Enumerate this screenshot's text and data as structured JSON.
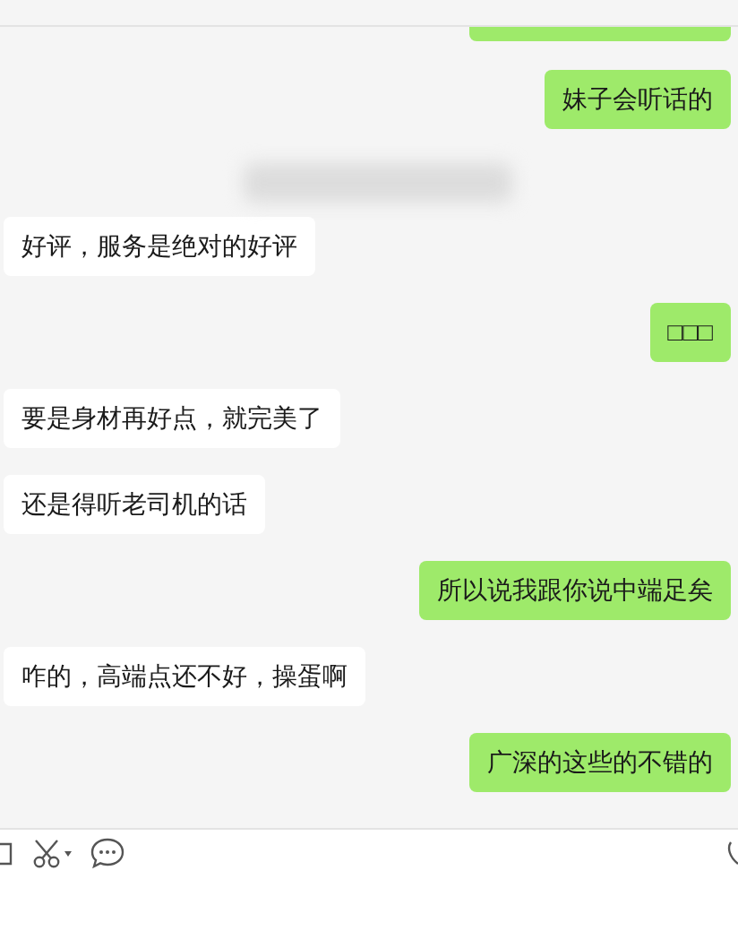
{
  "messages": [
    {
      "kind": "sent",
      "text": "妹子会听话的"
    },
    {
      "kind": "blurred"
    },
    {
      "kind": "received",
      "text": "好评，服务是绝对的好评"
    },
    {
      "kind": "sent",
      "text": "□□□"
    },
    {
      "kind": "received",
      "text": "要是身材再好点，就完美了"
    },
    {
      "kind": "received",
      "text": "还是得听老司机的话"
    },
    {
      "kind": "sent",
      "text": "所以说我跟你说中端足矣"
    },
    {
      "kind": "received",
      "text": "咋的，高端点还不好，操蛋啊"
    },
    {
      "kind": "sent",
      "text": "广深的这些的不错的"
    }
  ]
}
